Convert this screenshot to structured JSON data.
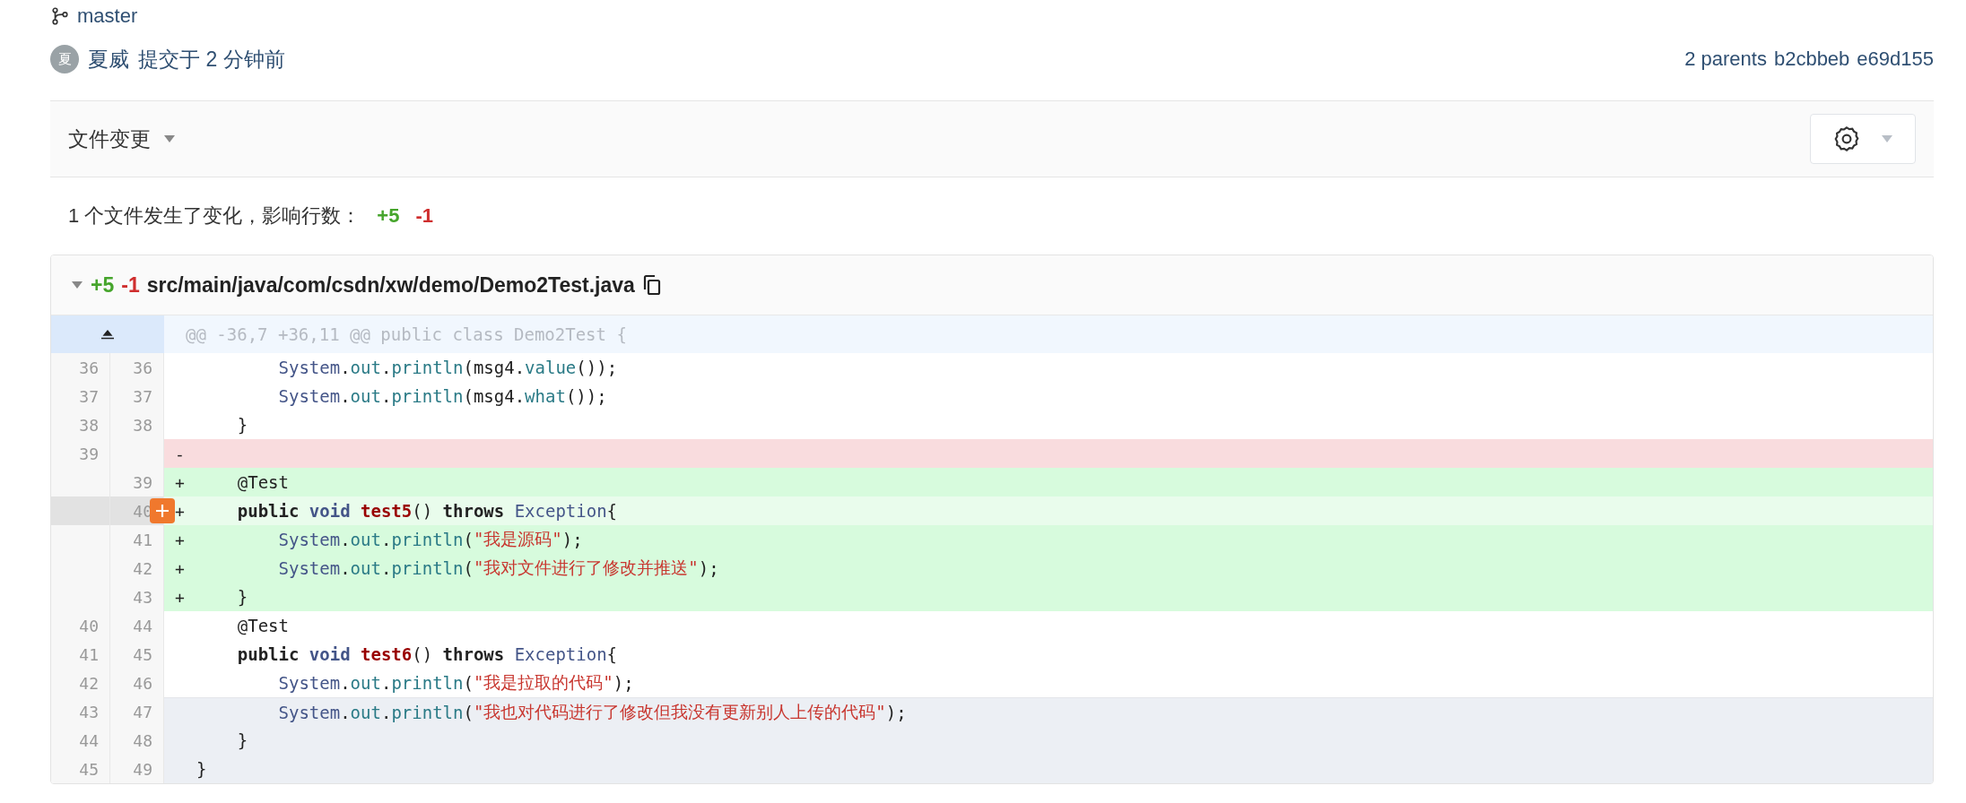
{
  "branch": {
    "name": "master"
  },
  "commit": {
    "avatar": "夏",
    "author": "夏威",
    "time": "提交于 2 分钟前",
    "parents_label": "2 parents",
    "parents": [
      "b2cbbeb",
      "e69d155"
    ]
  },
  "toolbar": {
    "title": "文件变更"
  },
  "summary": {
    "text": "1 个文件发生了变化，影响行数：",
    "added": "+5",
    "removed": "-1"
  },
  "file": {
    "expanded": true,
    "added": "+5",
    "removed": "-1",
    "path": "src/main/java/com/csdn/xw/demo/Demo2Test.java",
    "hunk": "@@ -36,7 +36,11 @@ public class Demo2Test {",
    "lines": [
      {
        "kind": "context",
        "old": "36",
        "new": "36",
        "tokens": [
          {
            "kind": "type",
            "text": "        System"
          },
          {
            "kind": "plain",
            "text": "."
          },
          {
            "kind": "member",
            "text": "out"
          },
          {
            "kind": "plain",
            "text": "."
          },
          {
            "kind": "member",
            "text": "println"
          },
          {
            "kind": "plain",
            "text": "(msg4."
          },
          {
            "kind": "member",
            "text": "value"
          },
          {
            "kind": "plain",
            "text": "());"
          }
        ]
      },
      {
        "kind": "context",
        "old": "37",
        "new": "37",
        "tokens": [
          {
            "kind": "type",
            "text": "        System"
          },
          {
            "kind": "plain",
            "text": "."
          },
          {
            "kind": "member",
            "text": "out"
          },
          {
            "kind": "plain",
            "text": "."
          },
          {
            "kind": "member",
            "text": "println"
          },
          {
            "kind": "plain",
            "text": "(msg4."
          },
          {
            "kind": "member",
            "text": "what"
          },
          {
            "kind": "plain",
            "text": "());"
          }
        ]
      },
      {
        "kind": "context",
        "old": "38",
        "new": "38",
        "tokens": [
          {
            "kind": "plain",
            "text": "    }"
          }
        ]
      },
      {
        "kind": "removed",
        "old": "39",
        "sign": "-"
      },
      {
        "kind": "added",
        "new": "39",
        "sign": "+",
        "tokens": [
          {
            "kind": "plain",
            "text": "    @Test"
          }
        ]
      },
      {
        "kind": "added",
        "new": "40",
        "sign": "+",
        "hovered": true,
        "tokens": [
          {
            "kind": "keyword",
            "text": "    public"
          },
          {
            "kind": "typekw",
            "text": " void"
          },
          {
            "kind": "function",
            "text": " test5"
          },
          {
            "kind": "plain",
            "text": "() "
          },
          {
            "kind": "keyword",
            "text": "throws"
          },
          {
            "kind": "type",
            "text": " Exception"
          },
          {
            "kind": "plain",
            "text": "{"
          }
        ]
      },
      {
        "kind": "added",
        "new": "41",
        "sign": "+",
        "tokens": [
          {
            "kind": "type",
            "text": "        System"
          },
          {
            "kind": "plain",
            "text": "."
          },
          {
            "kind": "member",
            "text": "out"
          },
          {
            "kind": "plain",
            "text": "."
          },
          {
            "kind": "member",
            "text": "println"
          },
          {
            "kind": "plain",
            "text": "("
          },
          {
            "kind": "string",
            "text": "\"我是源码\""
          },
          {
            "kind": "plain",
            "text": ");"
          }
        ]
      },
      {
        "kind": "added",
        "new": "42",
        "sign": "+",
        "tokens": [
          {
            "kind": "type",
            "text": "        System"
          },
          {
            "kind": "plain",
            "text": "."
          },
          {
            "kind": "member",
            "text": "out"
          },
          {
            "kind": "plain",
            "text": "."
          },
          {
            "kind": "member",
            "text": "println"
          },
          {
            "kind": "plain",
            "text": "("
          },
          {
            "kind": "string",
            "text": "\"我对文件进行了修改并推送\""
          },
          {
            "kind": "plain",
            "text": ");"
          }
        ]
      },
      {
        "kind": "added",
        "new": "43",
        "sign": "+",
        "tokens": [
          {
            "kind": "plain",
            "text": "    }"
          }
        ]
      },
      {
        "kind": "context",
        "old": "40",
        "new": "44",
        "tokens": [
          {
            "kind": "plain",
            "text": "    @Test"
          }
        ]
      },
      {
        "kind": "context",
        "old": "41",
        "new": "45",
        "tokens": [
          {
            "kind": "keyword",
            "text": "    public"
          },
          {
            "kind": "typekw",
            "text": " void"
          },
          {
            "kind": "function",
            "text": " test6"
          },
          {
            "kind": "plain",
            "text": "() "
          },
          {
            "kind": "keyword",
            "text": "throws"
          },
          {
            "kind": "type",
            "text": " Exception"
          },
          {
            "kind": "plain",
            "text": "{"
          }
        ]
      },
      {
        "kind": "context",
        "old": "42",
        "new": "46",
        "tokens": [
          {
            "kind": "type",
            "text": "        System"
          },
          {
            "kind": "plain",
            "text": "."
          },
          {
            "kind": "member",
            "text": "out"
          },
          {
            "kind": "plain",
            "text": "."
          },
          {
            "kind": "member",
            "text": "println"
          },
          {
            "kind": "plain",
            "text": "("
          },
          {
            "kind": "string",
            "text": "\"我是拉取的代码\""
          },
          {
            "kind": "plain",
            "text": ");"
          }
        ]
      },
      {
        "kind": "context",
        "old": "43",
        "new": "47",
        "shaded": true,
        "tokens": [
          {
            "kind": "type",
            "text": "        System"
          },
          {
            "kind": "plain",
            "text": "."
          },
          {
            "kind": "member",
            "text": "out"
          },
          {
            "kind": "plain",
            "text": "."
          },
          {
            "kind": "member",
            "text": "println"
          },
          {
            "kind": "plain",
            "text": "("
          },
          {
            "kind": "string",
            "text": "\"我也对代码进行了修改但我没有更新别人上传的代码\""
          },
          {
            "kind": "plain",
            "text": ");"
          }
        ]
      },
      {
        "kind": "context",
        "old": "44",
        "new": "48",
        "shaded": true,
        "tokens": [
          {
            "kind": "plain",
            "text": "    }"
          }
        ]
      },
      {
        "kind": "context",
        "old": "45",
        "new": "49",
        "shaded": true,
        "tokens": [
          {
            "kind": "plain",
            "text": "}"
          }
        ]
      }
    ]
  }
}
